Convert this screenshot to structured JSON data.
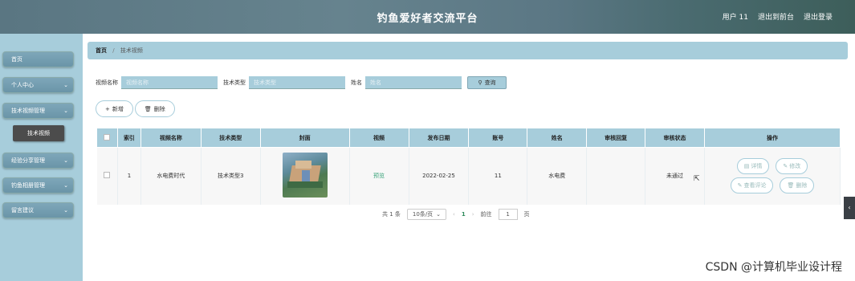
{
  "header": {
    "title": "钓鱼爱好者交流平台",
    "user_label": "用户 11",
    "back_front_label": "退出到前台",
    "logout_label": "退出登录"
  },
  "sidebar": {
    "items": [
      {
        "label": "首页"
      },
      {
        "label": "个人中心"
      },
      {
        "label": "技术视频管理"
      },
      {
        "label": "经验分享管理"
      },
      {
        "label": "钓鱼相册管理"
      },
      {
        "label": "留言建议"
      }
    ],
    "sub_item": "技术视频"
  },
  "breadcrumb": {
    "home": "首页",
    "separator": "/",
    "current": "技术视频"
  },
  "search": {
    "video_name_label": "视频名称",
    "video_name_placeholder": "视频名称",
    "tech_type_label": "技术类型",
    "tech_type_placeholder": "技术类型",
    "name_label": "姓名",
    "name_placeholder": "姓名",
    "search_button": "查询"
  },
  "actions": {
    "add_label": "新增",
    "delete_label": "删除"
  },
  "table": {
    "headers": [
      "索引",
      "视频名称",
      "技术类型",
      "封面",
      "视频",
      "发布日期",
      "账号",
      "姓名",
      "审核回复",
      "审核状态",
      "操作"
    ],
    "rows": [
      {
        "index": "1",
        "video_name": "水电费时代",
        "tech_type": "技术类型3",
        "video": "预览",
        "publish_date": "2022-02-25",
        "account": "11",
        "name": "水电费",
        "review_reply": "",
        "review_status": "未通过",
        "ops": {
          "detail": "详情",
          "edit": "修改",
          "comments": "查看评论",
          "delete": "删除"
        }
      }
    ]
  },
  "pagination": {
    "total": "共 1 条",
    "page_size": "10条/页",
    "current_page": "1",
    "goto_label": "前往",
    "goto_value": "1",
    "page_suffix": "页"
  },
  "watermark": "CSDN @计算机毕业设计程",
  "colors": {
    "accent": "#a7cddb",
    "submenu_active": "#4c4c4c",
    "link": "#3aa37a"
  }
}
